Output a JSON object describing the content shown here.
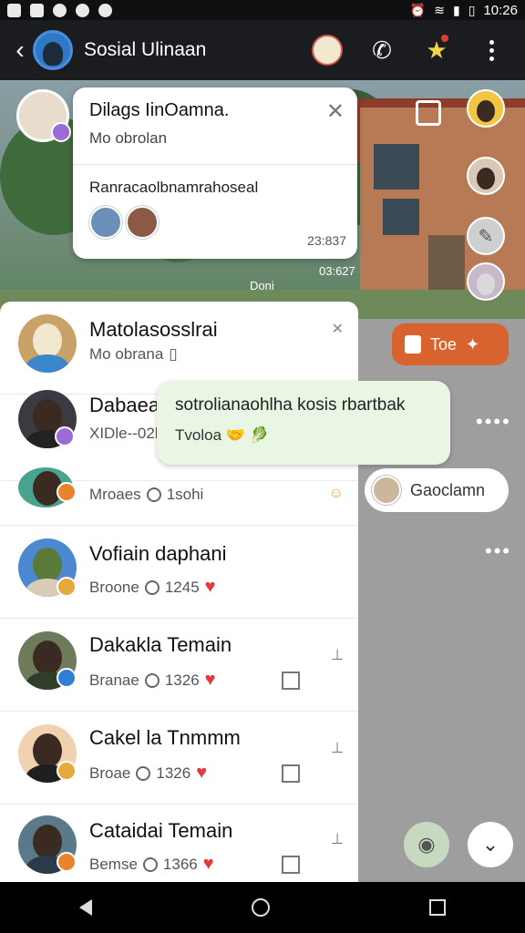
{
  "status_bar": {
    "time": "10:26"
  },
  "app_bar": {
    "title": "Sosial Ulinaan"
  },
  "popup": {
    "title": "Dilags IinOamna.",
    "subtitle": "Mo obrolan",
    "message": "Ranracaolbnamrahoseal",
    "time": "23:837",
    "float_time": "03:627",
    "float_label": "Doni"
  },
  "bubble": {
    "line1": "sotrolianaohlha kosis rbartbak",
    "line2": "Tvoloa 🤝 🥬"
  },
  "chips": {
    "orange_label": "Toe",
    "white_label": "Gaoclamn"
  },
  "list": [
    {
      "name": "Matolasosslrai",
      "sub": "Mo obrana",
      "meta": "",
      "badge_color": "#ffffff"
    },
    {
      "name": "Dabaeai",
      "sub": "XIDle--02b",
      "meta": "",
      "badge_color": "#9b6bd6"
    },
    {
      "name": "",
      "sub": "Mroaes",
      "meta": "1sohi",
      "badge_color": "#e8842c"
    },
    {
      "name": "Vofiain daphani",
      "sub": "Broone",
      "meta": "1245",
      "badge_color": "#e8a93c"
    },
    {
      "name": "Dakakla Temain",
      "sub": "Branae",
      "meta": "1326",
      "badge_color": "#2f7fd6"
    },
    {
      "name": "Cakel la Tnmmm",
      "sub": "Broae",
      "meta": "1326",
      "badge_color": "#e8a93c"
    },
    {
      "name": "Cataidai Temain",
      "sub": "Bemse",
      "meta": "1366",
      "badge_color": "#e8842c"
    }
  ]
}
